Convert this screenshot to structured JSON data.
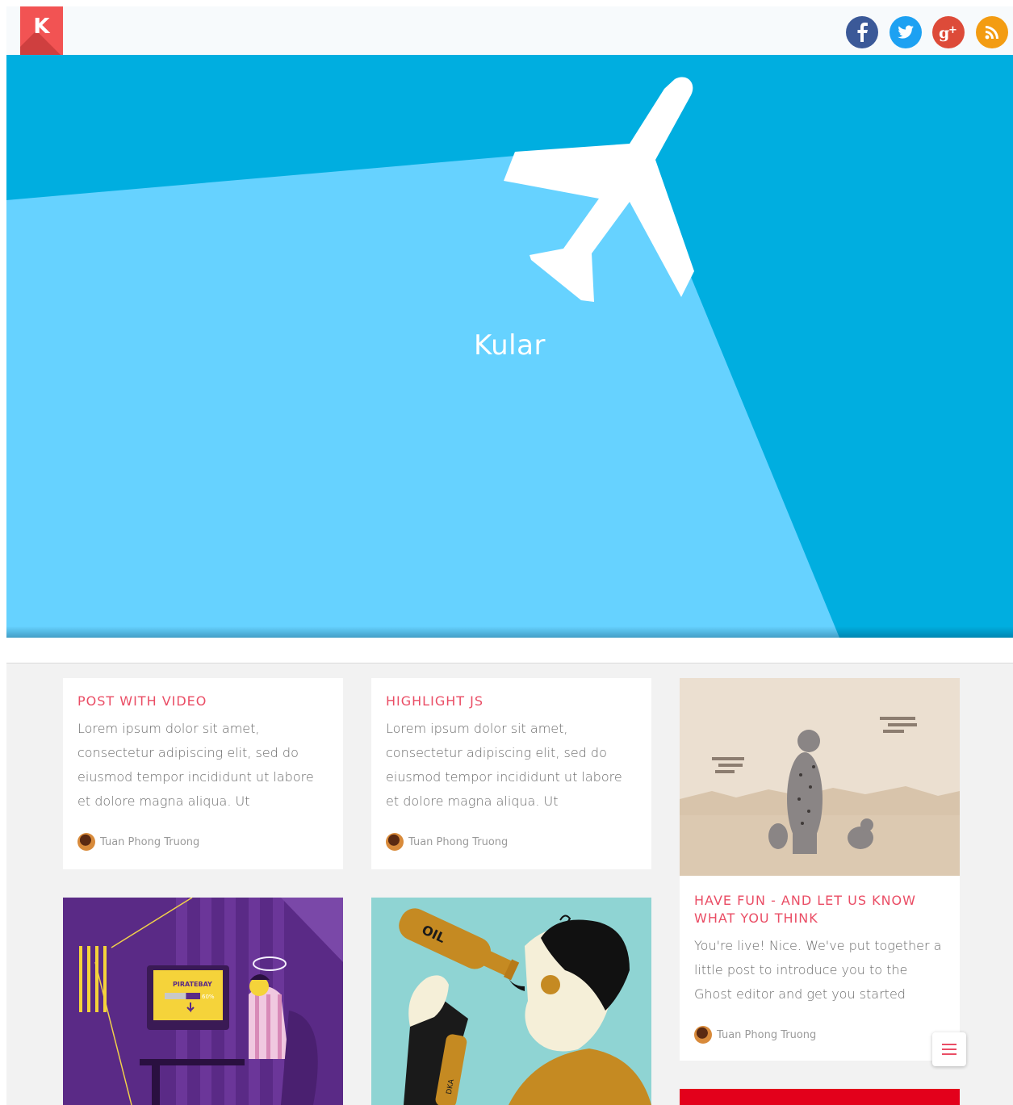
{
  "header": {
    "logo_letter": "K",
    "social": [
      {
        "name": "facebook",
        "glyph": "f",
        "color": "#3b5998"
      },
      {
        "name": "twitter",
        "glyph": "t",
        "color": "#1da1f2"
      },
      {
        "name": "google-plus",
        "glyph": "g+",
        "color": "#dd4b39"
      },
      {
        "name": "rss",
        "glyph": "rss",
        "color": "#f39c12"
      }
    ]
  },
  "hero": {
    "title": "Kular",
    "colors": {
      "dark": "#00aee0",
      "light": "#66d2ff",
      "plane": "#ffffff"
    }
  },
  "posts": [
    {
      "title": "POST WITH VIDEO",
      "excerpt": "Lorem ipsum dolor sit amet, consectetur adipiscing elit, sed do eiusmod tempor incididunt ut labore et dolore magna aliqua. Ut",
      "author": "Tuan Phong Truong"
    },
    {
      "title": "HIGHLIGHT JS",
      "excerpt": "Lorem ipsum dolor sit amet, consectetur adipiscing elit, sed do eiusmod tempor incididunt ut labore et dolore magna aliqua. Ut",
      "author": "Tuan Phong Truong"
    },
    {
      "title": "HAVE FUN - AND LET US KNOW WHAT YOU THINK",
      "excerpt": "You're live! Nice. We've put together a little post to introduce you to the Ghost editor and get you started",
      "author": "Tuan Phong Truong"
    }
  ],
  "image_cards": {
    "piracy": {
      "banner_text": "PIRATEBAY",
      "progress_label": "60%",
      "progress": 0.6
    },
    "drinker": {
      "bottle_label": "OIL",
      "second_bottle_label": "DKA"
    }
  },
  "accent_color": "#ea4d65"
}
